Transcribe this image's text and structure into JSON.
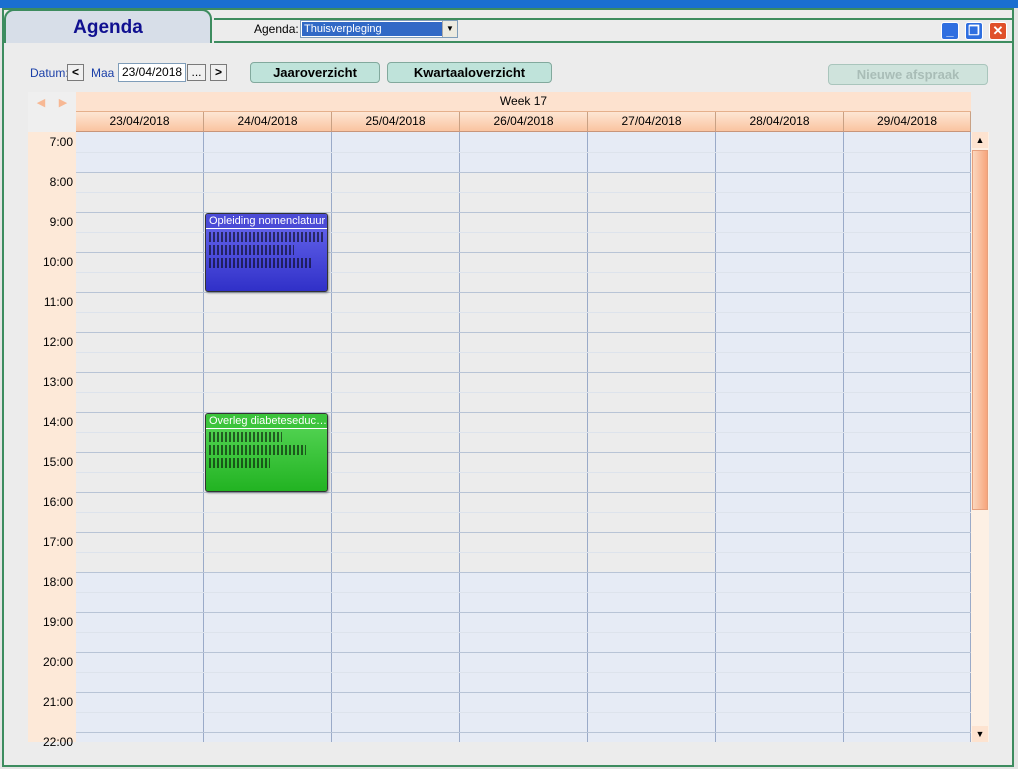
{
  "window": {
    "tab_title": "Agenda",
    "agenda_label": "Agenda:",
    "agenda_selected": "Thuisverpleging"
  },
  "toolbar": {
    "datum_label": "Datum:",
    "prev": "<",
    "view_label": "Maa",
    "date_value": "23/04/2018",
    "picker": "...",
    "next": ">",
    "year_button": "Jaaroverzicht",
    "quarter_button": "Kwartaaloverzicht",
    "new_button": "Nieuwe afspraak"
  },
  "calendar": {
    "week": "Week 17",
    "days": [
      "23/04/2018",
      "24/04/2018",
      "25/04/2018",
      "26/04/2018",
      "27/04/2018",
      "28/04/2018",
      "29/04/2018"
    ],
    "hours": [
      "7:00",
      "8:00",
      "9:00",
      "10:00",
      "11:00",
      "12:00",
      "13:00",
      "14:00",
      "15:00",
      "16:00",
      "17:00",
      "18:00",
      "19:00",
      "20:00",
      "21:00",
      "22:00"
    ],
    "appointments": [
      {
        "title": "Opleiding nomenclatuur",
        "day": "24/04/2018",
        "start": "9:00",
        "end": "11:00",
        "color": "#3333cc"
      },
      {
        "title": "Overleg diabeteseduc…",
        "day": "24/04/2018",
        "start": "14:00",
        "end": "16:00",
        "color": "#22b322"
      }
    ]
  },
  "colors": {
    "frame": "#3d8c5f",
    "header_peach": "#fac4a0",
    "offhours": "#e6ebf5"
  }
}
